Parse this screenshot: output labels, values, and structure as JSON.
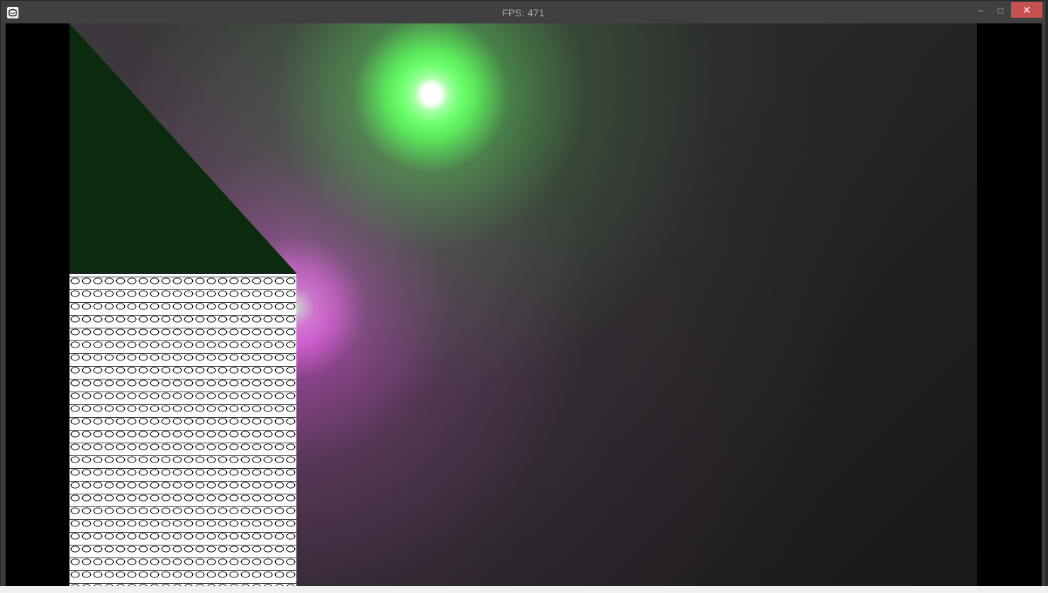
{
  "window": {
    "title": "FPS: 471",
    "icon": "app-icon",
    "controls": {
      "minimize_icon": "minimize-icon",
      "maximize_icon": "maximize-icon",
      "close_icon": "close-icon",
      "minimize_glyph": "–",
      "maximize_glyph": "□",
      "close_glyph": "✕"
    },
    "close_color": "#c75050"
  },
  "scene": {
    "lights": [
      {
        "name": "green-light",
        "color": "#6dff6d"
      },
      {
        "name": "magenta-light",
        "color": "#ff7cff"
      }
    ],
    "triangle_color": "#0b2a0e",
    "tile_panel_color": "#ffffff"
  }
}
